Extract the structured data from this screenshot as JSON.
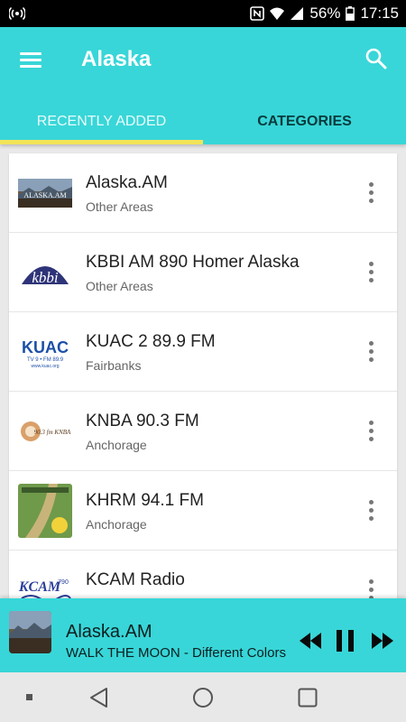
{
  "status_bar": {
    "battery": "56%",
    "time": "17:15"
  },
  "app_bar": {
    "title": "Alaska",
    "menu_icon": "hamburger-menu-icon",
    "search_icon": "search-icon"
  },
  "tabs": [
    {
      "label": "RECENTLY ADDED",
      "active": true
    },
    {
      "label": "CATEGORIES",
      "active": false
    }
  ],
  "stations": [
    {
      "name": "Alaska.AM",
      "category": "Other Areas",
      "logo": "alaska-am-logo"
    },
    {
      "name": "KBBI AM 890 Homer Alaska",
      "category": "Other Areas",
      "logo": "kbbi-logo"
    },
    {
      "name": "KUAC 2 89.9 FM",
      "category": "Fairbanks",
      "logo": "kuac-logo"
    },
    {
      "name": "KNBA 90.3 FM",
      "category": "Anchorage",
      "logo": "knba-logo"
    },
    {
      "name": "KHRM 94.1 FM",
      "category": "Anchorage",
      "logo": "khrm-logo"
    },
    {
      "name": "KCAM Radio",
      "category": "",
      "logo": "kcam-logo"
    }
  ],
  "logos": {
    "alaska_am_text": "ALASKA.AM",
    "kbbi_text": "kbbi",
    "kuac_text": "KUAC",
    "kuac_sub": "TV 9 • FM 89.9",
    "kuac_url": "www.kuac.org",
    "knba_text": "90.3 fm KNBA",
    "kcam_text": "KCAM",
    "kcam_num": "790"
  },
  "player": {
    "station": "Alaska.AM",
    "track": "WALK THE MOON - Different Colors",
    "controls": [
      "rewind-icon",
      "pause-icon",
      "fast-forward-icon"
    ]
  },
  "colors": {
    "accent": "#38d6d8",
    "tab_indicator": "#f2e45a"
  }
}
